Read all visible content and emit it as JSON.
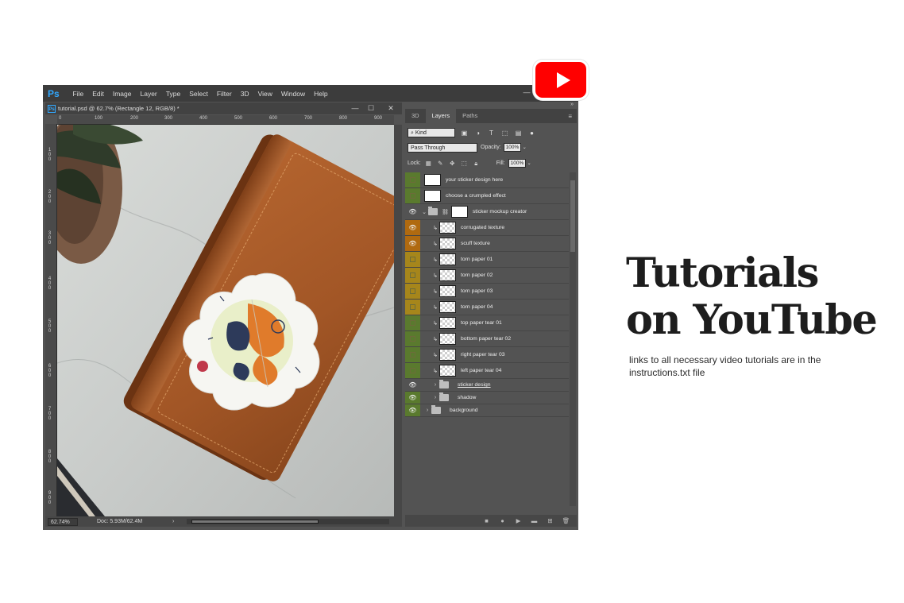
{
  "app": {
    "logo": "Ps"
  },
  "menu": [
    "File",
    "Edit",
    "Image",
    "Layer",
    "Type",
    "Select",
    "Filter",
    "3D",
    "View",
    "Window",
    "Help"
  ],
  "document": {
    "tab_title": "tutorial.psd @ 62.7% (Rectangle 12, RGB/8) *",
    "zoom": "62.74%",
    "doc_info": "Doc: 5.93M/62.4M"
  },
  "ruler_h": [
    "0",
    "100",
    "200",
    "300",
    "400",
    "500",
    "600",
    "700",
    "800",
    "900"
  ],
  "ruler_v": [
    "1 0 0",
    "2 0 0",
    "3 0 0",
    "4 0 0",
    "5 0 0",
    "6 0 0",
    "7 0 0",
    "8 0 0",
    "9 0 0"
  ],
  "panel": {
    "tabs": [
      "3D",
      "Layers",
      "Paths"
    ],
    "active_tab": "Layers",
    "kind_label": "Kind",
    "blend_mode": "Pass Through",
    "opacity_label": "Opacity:",
    "opacity_value": "100%",
    "lock_label": "Lock:",
    "fill_label": "Fill:",
    "fill_value": "100%"
  },
  "layers": [
    {
      "name": "your sticker design here",
      "color": "#5a7a2e",
      "visible": false
    },
    {
      "name": "choose a crumpled effect",
      "color": "#5a7a2e",
      "visible": false
    },
    {
      "name": "sticker mockup creator",
      "color": "#535353",
      "visible": true
    },
    {
      "name": "corrugated texture",
      "color": "#b06a10",
      "visible": true
    },
    {
      "name": "scuff texture",
      "color": "#b06a10",
      "visible": true
    },
    {
      "name": "torn paper 01",
      "color": "#a6861b",
      "visible": false
    },
    {
      "name": "torn paper 02",
      "color": "#a6861b",
      "visible": false
    },
    {
      "name": "torn paper 03",
      "color": "#a6861b",
      "visible": false
    },
    {
      "name": "torn paper 04",
      "color": "#a6861b",
      "visible": false
    },
    {
      "name": "top paper tear 01",
      "color": "#5a7a2e",
      "visible": false
    },
    {
      "name": "bottom paper tear 02",
      "color": "#5a7a2e",
      "visible": false
    },
    {
      "name": "right paper tear 03",
      "color": "#5a7a2e",
      "visible": false
    },
    {
      "name": "left paper tear 04",
      "color": "#5a7a2e",
      "visible": false
    },
    {
      "name": "sticker design",
      "color": "#535353",
      "visible": true
    },
    {
      "name": "shadow",
      "color": "#5a7a2e",
      "visible": true
    },
    {
      "name": "background",
      "color": "#5a7a2e",
      "visible": true
    }
  ],
  "headline": {
    "line1": "Tutorials",
    "line2": "on YouTube"
  },
  "subtitle": "links to all necessary video tutorials are in the instructions.txt file",
  "colors": {
    "youtube_red": "#ff0000",
    "ps_blue": "#31a8ff",
    "label_green": "#5a7a2e",
    "label_orange": "#b06a10",
    "label_yellow": "#a6861b"
  }
}
